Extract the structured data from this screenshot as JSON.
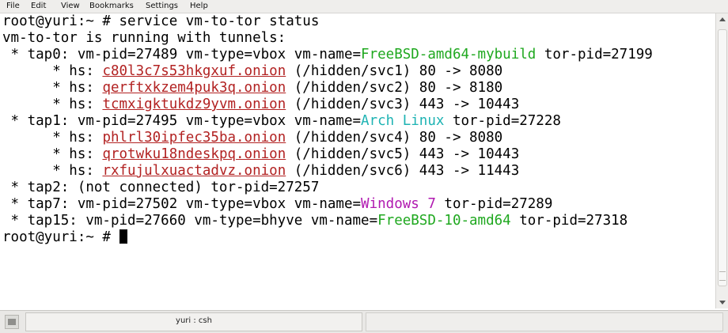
{
  "menu": {
    "file": "File",
    "edit": "Edit",
    "view": "View",
    "bookmarks": "Bookmarks",
    "settings": "Settings",
    "help": "Help"
  },
  "terminal": {
    "line1": "root@yuri:~ # service vm-to-tor status",
    "line2": "vm-to-tor is running with tunnels:",
    "tap0": {
      "prefix": " * tap0: vm-pid=27489 vm-type=vbox vm-name=",
      "vm_name": "FreeBSD-amd64-mybuild",
      "suffix": " tor-pid=27199",
      "hs": [
        {
          "prefix": "      * hs: ",
          "onion": "c80l3c7s53hkgxuf.onion",
          "rest": " (/hidden/svc1) 80 -> 8080"
        },
        {
          "prefix": "      * hs: ",
          "onion": "qerftxkzem4puk3q.onion",
          "rest": " (/hidden/svc2) 80 -> 8180"
        },
        {
          "prefix": "      * hs: ",
          "onion": "tcmxigktukdz9yvm.onion",
          "rest": " (/hidden/svc3) 443 -> 10443"
        }
      ]
    },
    "tap1": {
      "prefix": " * tap1: vm-pid=27495 vm-type=vbox vm-name=",
      "vm_name": "Arch Linux",
      "suffix": " tor-pid=27228",
      "hs": [
        {
          "prefix": "      * hs: ",
          "onion": "phlrl30ipfec35ba.onion",
          "rest": " (/hidden/svc4) 80 -> 8080"
        },
        {
          "prefix": "      * hs: ",
          "onion": "qrotwku18ndeskpq.onion",
          "rest": " (/hidden/svc5) 443 -> 10443"
        },
        {
          "prefix": "      * hs: ",
          "onion": "rxfujulxuactadvz.onion",
          "rest": " (/hidden/svc6) 443 -> 11443"
        }
      ]
    },
    "tap2": " * tap2: (not connected) tor-pid=27257",
    "tap7": {
      "prefix": " * tap7: vm-pid=27502 vm-type=vbox vm-name=",
      "vm_name": "Windows 7",
      "suffix": " tor-pid=27289"
    },
    "tap15": {
      "prefix": " * tap15: vm-pid=27660 vm-type=bhyve vm-name=",
      "vm_name": "FreeBSD-10-amd64",
      "suffix": " tor-pid=27318"
    },
    "prompt": "root@yuri:~ # "
  },
  "colors": {
    "vm_name_green": "#1fa81f",
    "vm_name_cyan": "#1eb3b3",
    "vm_name_magenta": "#b019b0",
    "onion_link": "#b22222"
  },
  "taskbar": {
    "window_title": "yuri : csh"
  }
}
